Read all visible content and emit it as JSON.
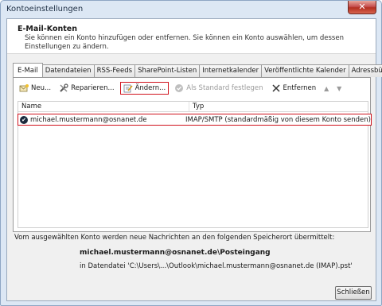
{
  "window": {
    "title": "Kontoeinstellungen",
    "close_glyph": "✕"
  },
  "header": {
    "title": "E-Mail-Konten",
    "description": "Sie können ein Konto hinzufügen oder entfernen. Sie können ein Konto auswählen, um dessen Einstellungen zu ändern."
  },
  "tabs": [
    {
      "label": "E-Mail",
      "active": true
    },
    {
      "label": "Datendateien"
    },
    {
      "label": "RSS-Feeds"
    },
    {
      "label": "SharePoint-Listen"
    },
    {
      "label": "Internetkalender"
    },
    {
      "label": "Veröffentlichte Kalender"
    },
    {
      "label": "Adressbücher"
    }
  ],
  "toolbar": {
    "new_label": "Neu...",
    "repair_label": "Reparieren...",
    "change_label": "Ändern...",
    "default_label": "Als Standard festlegen",
    "remove_label": "Entfernen",
    "up_glyph": "▲",
    "down_glyph": "▼"
  },
  "accounts_list": {
    "columns": [
      "Name",
      "Typ"
    ],
    "rows": [
      {
        "name": "michael.mustermann@osnanet.de",
        "type": "IMAP/SMTP (standardmäßig von diesem Konto senden)",
        "default": true
      }
    ]
  },
  "delivery": {
    "description": "Vom ausgewählten Konto werden neue Nachrichten an den folgenden Speicherort übermittelt:",
    "folder": "michael.mustermann@osnanet.de\\Posteingang",
    "file": "in Datendatei 'C:\\Users\\...\\Outlook\\michael.mustermann@osnanet.de (IMAP).pst'"
  },
  "footer": {
    "close_label": "Schließen"
  },
  "icons": {
    "new": "new-mail-icon",
    "repair": "tools-icon",
    "change": "edit-icon",
    "default": "check-circle-icon",
    "remove": "close-icon",
    "default_account": "check-circle-icon"
  },
  "colors": {
    "highlight": "#d0131d",
    "frame": "#dce7f4"
  }
}
